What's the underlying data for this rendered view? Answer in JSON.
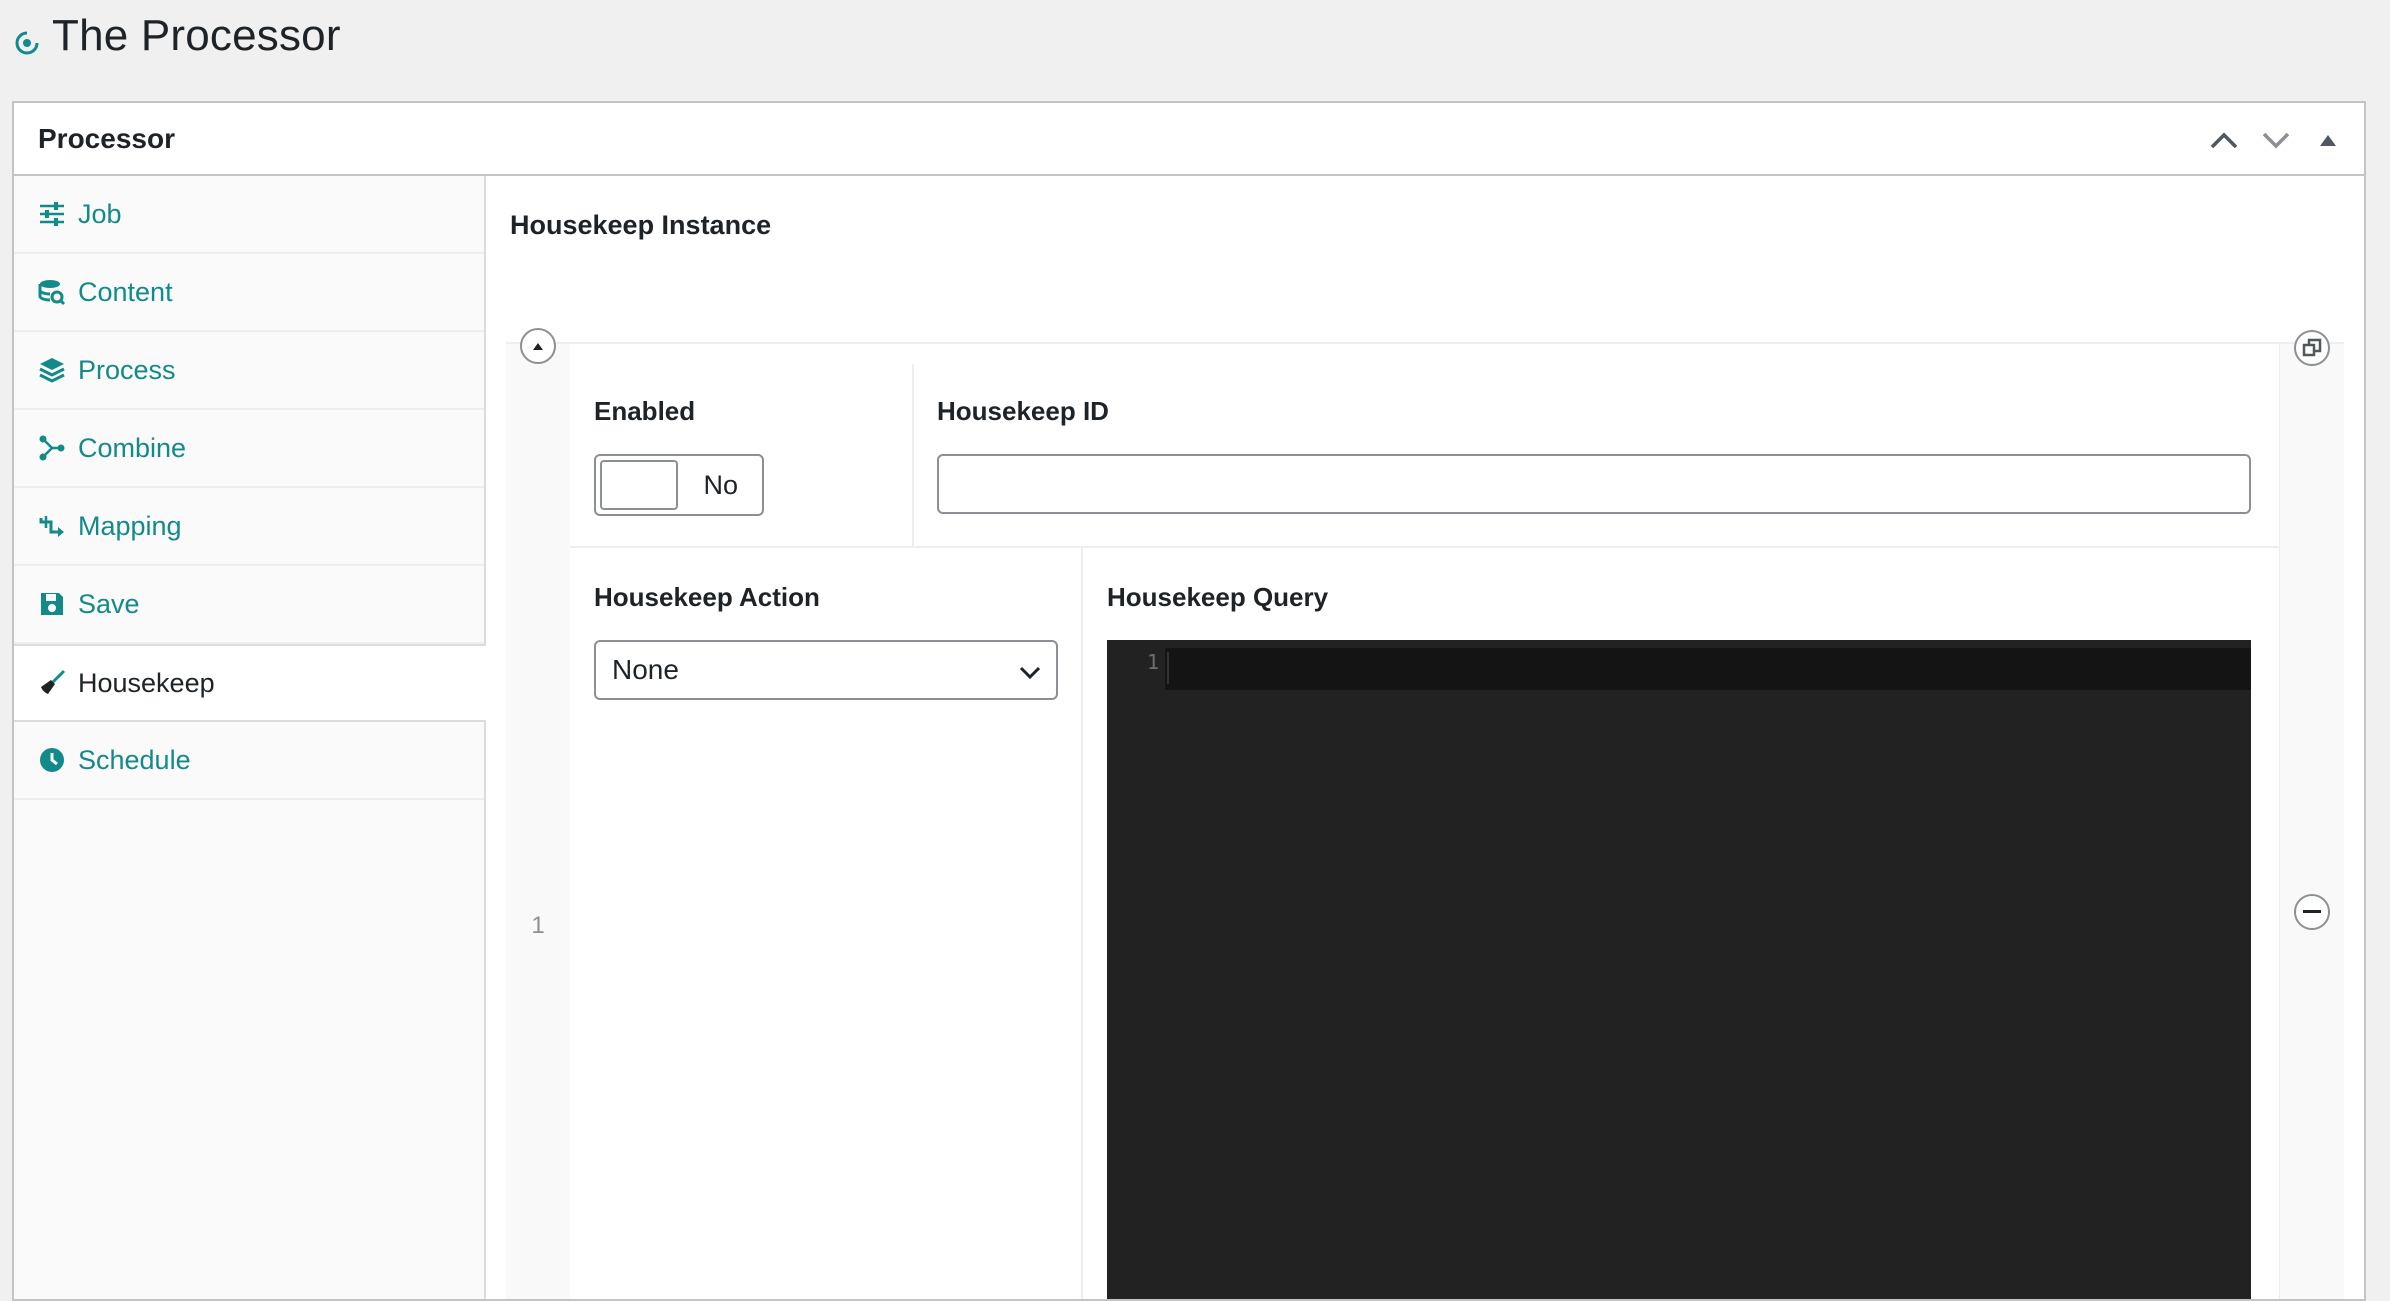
{
  "page": {
    "title": "The Processor"
  },
  "postbox": {
    "title": "Processor",
    "actions": {
      "move_up": "Move up",
      "move_down": "Move down",
      "toggle": "Toggle panel"
    }
  },
  "tabs": [
    {
      "label": "Job",
      "icon": "sliders-icon",
      "active": false
    },
    {
      "label": "Content",
      "icon": "database-search-icon",
      "active": false
    },
    {
      "label": "Process",
      "icon": "layers-icon",
      "active": false
    },
    {
      "label": "Combine",
      "icon": "merge-icon",
      "active": false
    },
    {
      "label": "Mapping",
      "icon": "mapping-arrow-icon",
      "active": false
    },
    {
      "label": "Save",
      "icon": "floppy-disk-icon",
      "active": false
    },
    {
      "label": "Housekeep",
      "icon": "broom-icon",
      "active": true
    },
    {
      "label": "Schedule",
      "icon": "clock-icon",
      "active": false
    }
  ],
  "panel": {
    "title": "Housekeep Instance",
    "row_number": "1",
    "fields": {
      "enabled": {
        "label": "Enabled",
        "value": "No"
      },
      "housekeep_id": {
        "label": "Housekeep ID",
        "value": ""
      },
      "housekeep_action": {
        "label": "Housekeep Action",
        "value": "None"
      },
      "housekeep_query": {
        "label": "Housekeep Query",
        "line_number": "1",
        "value": ""
      }
    }
  },
  "colors": {
    "accent": "#138a8a",
    "editor_bg": "#222222",
    "page_bg": "#f0f0f1"
  }
}
